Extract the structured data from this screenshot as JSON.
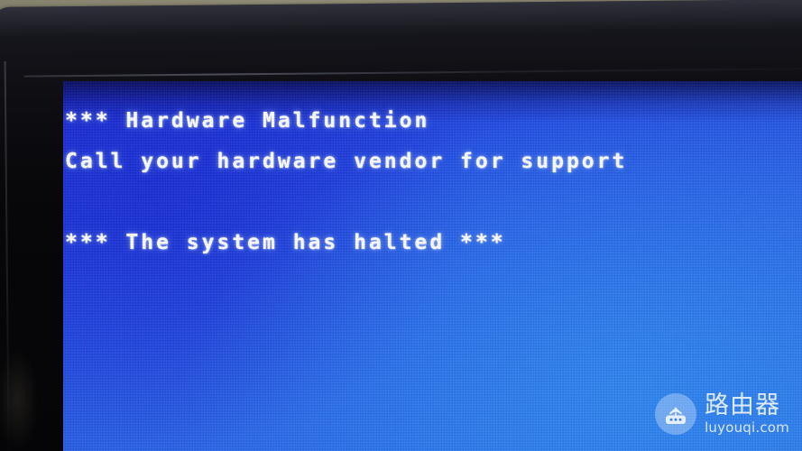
{
  "photo": {
    "subject": "monitor-displaying-hardware-malfunction-screen",
    "wall_color": "#8a8770",
    "bezel_color": "#0a0a0e"
  },
  "screen": {
    "background_color": "#2450e6",
    "text_color": "#ffffff",
    "console_lines": [
      "*** Hardware Malfunction",
      "Call your hardware vendor for support",
      "",
      "*** The system has halted ***"
    ]
  },
  "watermark": {
    "icon": "router-icon",
    "brand_cn": "路由器",
    "brand_domain": "luyouqi.com",
    "color": "#ffffff"
  }
}
